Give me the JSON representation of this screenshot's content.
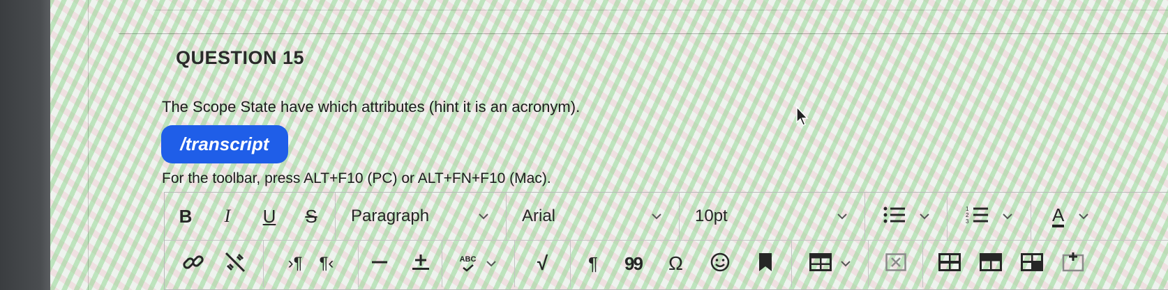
{
  "question": {
    "title": "QUESTION 15",
    "text": "The Scope State have which attributes (hint it is an acronym).",
    "transcript_button": "/transcript",
    "toolbar_hint": "For the toolbar, press ALT+F10 (PC) or ALT+FN+F10 (Mac)."
  },
  "toolbar": {
    "bold": "B",
    "italic": "I",
    "underline": "U",
    "strike": "S",
    "block_format": "Paragraph",
    "font_family": "Arial",
    "font_size": "10pt",
    "text_color_label": "A",
    "spellcheck_label": "ABC",
    "mathjax": "√",
    "paragraph_mark": "¶",
    "quote": "99",
    "special_char": "Ω",
    "ltr": "›¶",
    "rtl": "¶‹"
  },
  "colors": {
    "transcript_bg": "#1f5ee8",
    "text": "#1d1d1d"
  }
}
